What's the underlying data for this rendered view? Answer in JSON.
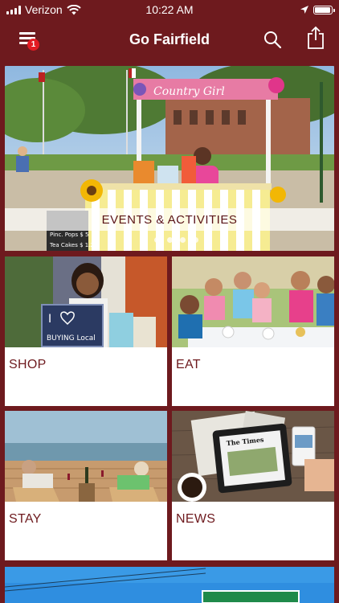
{
  "status_bar": {
    "carrier": "Verizon",
    "time": "10:22 AM"
  },
  "nav": {
    "title": "Go Fairfield",
    "menu_badge_count": "1",
    "icons": [
      "menu-icon",
      "search-icon",
      "share-icon"
    ]
  },
  "hero": {
    "label": "EVENTS & ACTIVITIES",
    "stand_sign": "Country Girl",
    "menu_board": [
      "Pinc. Pops $ 5",
      "Tea Cakes $ 1.25"
    ],
    "carousel_dots": 5
  },
  "tiles": [
    {
      "label": "SHOP",
      "photo_sign_top": "I",
      "photo_sign_bottom": "BUYING Local"
    },
    {
      "label": "EAT"
    },
    {
      "label": "STAY"
    },
    {
      "label": "NEWS",
      "newspaper_masthead": "The Times"
    }
  ],
  "colors": {
    "brand": "#6e1a1e",
    "badge": "#e21b23"
  }
}
